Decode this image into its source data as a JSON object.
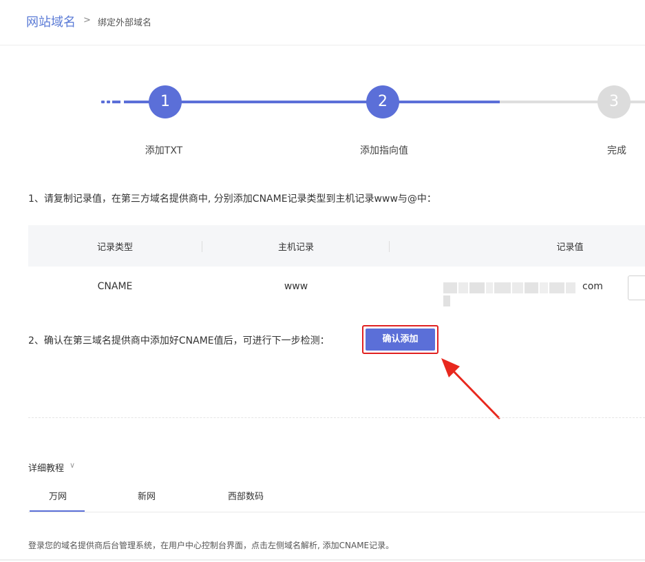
{
  "breadcrumb": {
    "root": "网站域名",
    "separator": ">",
    "current": "绑定外部域名"
  },
  "steps": [
    {
      "number": "1",
      "label": "添加TXT",
      "state": "done"
    },
    {
      "number": "2",
      "label": "添加指向值",
      "state": "active"
    },
    {
      "number": "3",
      "label": "完成",
      "state": "pending"
    }
  ],
  "instructions": {
    "step1": "1、请复制记录值，在第三方域名提供商中, 分别添加CNAME记录类型到主机记录www与@中：",
    "step2": "2、确认在第三域名提供商中添加好CNAME值后，可进行下一步检测："
  },
  "table": {
    "headers": [
      "记录类型",
      "主机记录",
      "记录值"
    ],
    "rows": [
      {
        "type": "CNAME",
        "host": "www",
        "value_suffix": "com"
      }
    ]
  },
  "confirm_button": {
    "label": "确认添加"
  },
  "tutorial": {
    "title": "详细教程",
    "chevron": "∨",
    "tabs": [
      "万网",
      "新网",
      "西部数码"
    ],
    "active_tab": 0,
    "description": "登录您的域名提供商后台管理系统，在用户中心控制台界面，点击左侧域名解析, 添加CNAME记录。"
  },
  "colors": {
    "accent": "#5b6fd8",
    "breadcrumb_link": "#5b7bd6",
    "highlight_red": "#e02020",
    "inactive_step": "#dcdcdc"
  }
}
